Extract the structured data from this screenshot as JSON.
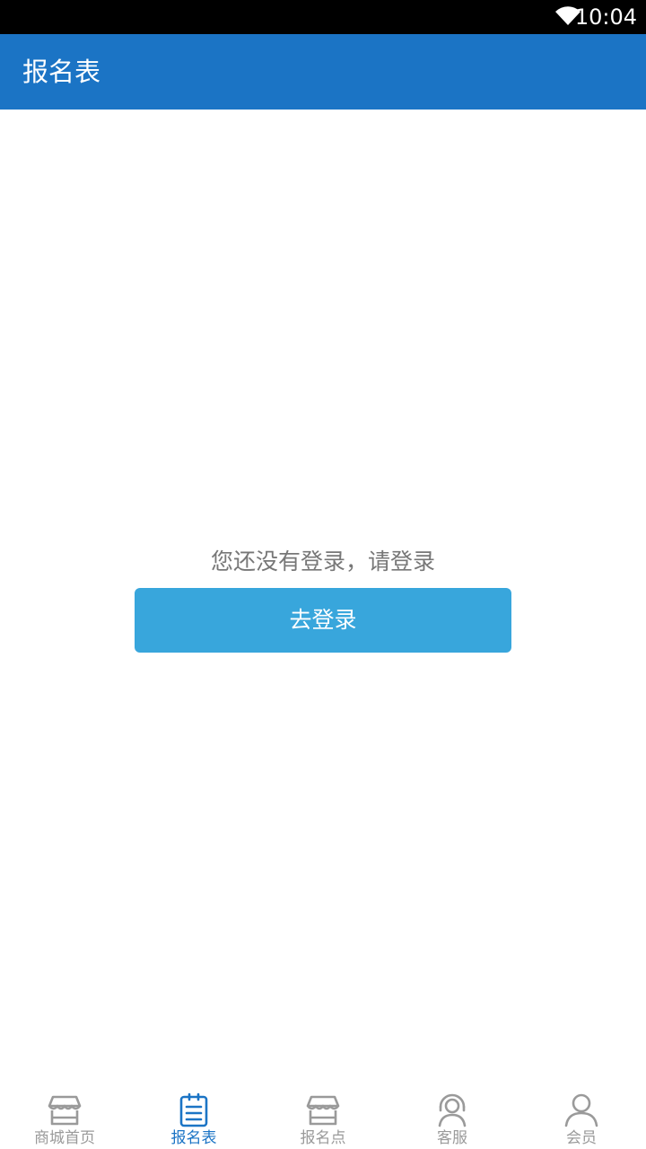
{
  "status_bar": {
    "time": "10:04"
  },
  "app_bar": {
    "title": "报名表"
  },
  "main": {
    "message": "您还没有登录，请登录",
    "login_button": "去登录"
  },
  "tab_bar": {
    "active_index": 1,
    "tabs": [
      {
        "label": "商城首页",
        "icon": "store-icon"
      },
      {
        "label": "报名表",
        "icon": "clipboard-list-icon"
      },
      {
        "label": "报名点",
        "icon": "store-icon"
      },
      {
        "label": "客服",
        "icon": "headset-user-icon"
      },
      {
        "label": "会员",
        "icon": "user-icon"
      }
    ]
  },
  "colors": {
    "primary": "#1b74c5",
    "button": "#38a6dc",
    "inactive": "#9a9a9a",
    "message": "#777777"
  }
}
